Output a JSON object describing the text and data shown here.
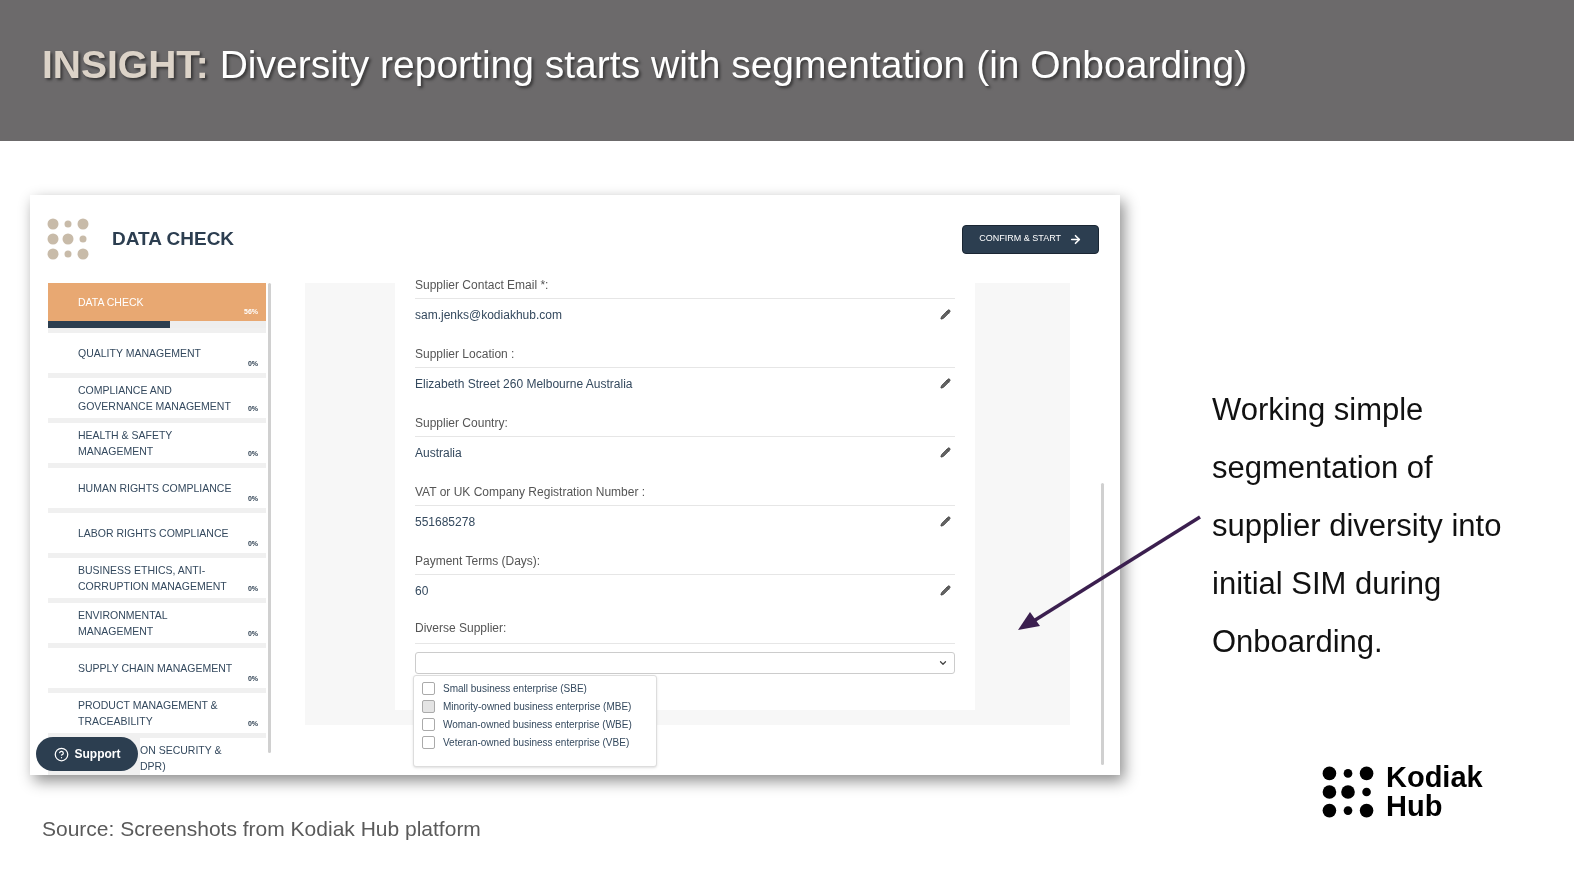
{
  "header": {
    "title": "**INSIGHT:** Diversity reporting starts with segmentation (in Onboarding)"
  },
  "app": {
    "title": "DATA CHECK",
    "confirm_button": "CONFIRM & START",
    "sidebar": {
      "items": [
        {
          "label": "DATA CHECK",
          "percent": "56%",
          "selected": true,
          "level": 0.56
        },
        {
          "label": "QUALITY MANAGEMENT",
          "percent": "0%",
          "selected": false
        },
        {
          "label": "COMPLIANCE AND GOVERNANCE MANAGEMENT",
          "percent": "0%",
          "selected": false
        },
        {
          "label": "HEALTH & SAFETY MANAGEMENT",
          "percent": "0%",
          "selected": false
        },
        {
          "label": "HUMAN RIGHTS COMPLIANCE",
          "percent": "0%",
          "selected": false
        },
        {
          "label": "LABOR RIGHTS COMPLIANCE",
          "percent": "0%",
          "selected": false
        },
        {
          "label": "BUSINESS ETHICS, ANTI-CORRUPTION MANAGEMENT",
          "percent": "0%",
          "selected": false
        },
        {
          "label": "ENVIRONMENTAL MANAGEMENT",
          "percent": "0%",
          "selected": false
        },
        {
          "label": "SUPPLY CHAIN MANAGEMENT",
          "percent": "0%",
          "selected": false
        },
        {
          "label": "PRODUCT MANAGEMENT & TRACEABILITY",
          "percent": "0%",
          "selected": false
        },
        {
          "label": "ON SECURITY &\nDPR)",
          "selected": false,
          "kind": "covered"
        }
      ]
    },
    "support_button": "Support",
    "form": {
      "fields": [
        {
          "label": "Supplier Contact Email *:",
          "value": "sam.jenks@kodiakhub.com"
        },
        {
          "label": "Supplier Location :",
          "value": "Elizabeth Street 260 Melbourne Australia"
        },
        {
          "label": "Supplier Country:",
          "value": "Australia"
        },
        {
          "label": "VAT or UK Company Registration Number :",
          "value": "551685278"
        },
        {
          "label": "Payment Terms (Days):",
          "value": "60"
        }
      ],
      "diverse_supplier": {
        "label": "Diverse Supplier:",
        "options": [
          {
            "label": "Small business enterprise (SBE)",
            "checked": false,
            "hovered": false
          },
          {
            "label": "Minority-owned business enterprise (MBE)",
            "checked": false,
            "hovered": true
          },
          {
            "label": "Woman-owned business enterprise (WBE)",
            "checked": false,
            "hovered": false
          },
          {
            "label": "Veteran-owned business enterprise (VBE)",
            "checked": false,
            "hovered": false
          }
        ]
      }
    }
  },
  "note": "Working simple segmentation of supplier diversity into initial SIM during Onboarding.",
  "source": "Source: Screenshots from Kodiak Hub platform",
  "logo": {
    "line_1": "Kodiak",
    "line_2": "Hub"
  }
}
